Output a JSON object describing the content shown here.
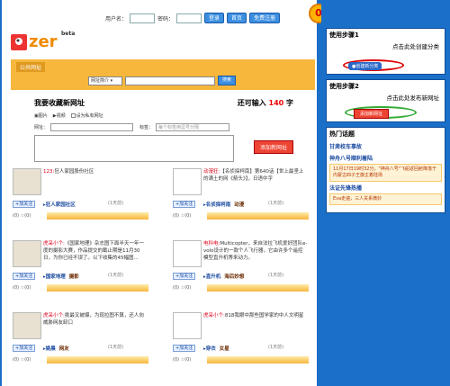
{
  "header": {
    "username_label": "用户名：",
    "password_label": "密码：",
    "login": "登录",
    "home": "首页",
    "register": "免费注册",
    "notice_count": "0",
    "logo_text": "zer",
    "beta": "beta"
  },
  "tabs": {
    "public": "公共网址"
  },
  "search": {
    "select": "网址简介",
    "button": "搜索"
  },
  "post": {
    "title": "我要收藏新网址",
    "remain_label": "还可输入",
    "remain_count": "140",
    "remain_unit": "字",
    "opt_image": "图片",
    "opt_video": "视频",
    "opt_private": "设为私有网址",
    "url_label": "网址：",
    "tag_label": "标签：",
    "tag_placeholder": "每个标签用逗号分隔",
    "add_button": "添加新网址"
  },
  "cards": [
    {
      "user": "123:",
      "text": "狂人家园股份社区",
      "time": "(1天前)",
      "follow": "加关注",
      "stat": "(0) ☆(0)",
      "tag1": "狂人家园社区",
      "tag2": ""
    },
    {
      "user": "动漫狂:",
      "text": "【名侦探柯南】第640话【世上最坚上的满土的网《箭头》】，日语中字",
      "time": "(1天前)",
      "follow": "加关注",
      "stat": "(0) ☆(0)",
      "tag1": "名侦探柯南",
      "tag2": "动漫"
    },
    {
      "user": "虎采小个:",
      "text": "《国家地理》杂志图下面半天一年一度的摄影大赛，作品提交的截止期是11月30日，为你已经不误了。以下收集的45幅图...",
      "time": "(1天前)",
      "follow": "加关注",
      "stat": "(0) ☆(0)",
      "tag1": "国家地理",
      "tag2": "摄影"
    },
    {
      "user": "电科电:",
      "text": "Multicopter，来自法拉飞机爱好团队e-volo设计的一款个人飞行器，它由许多个遥控模型直升机等来动力。",
      "time": "(1天前)",
      "follow": "加关注",
      "stat": "(0) ☆(0)",
      "tag1": "直升机",
      "tag2": "海后妙想"
    },
    {
      "user": "虎采小个:",
      "text": "挑最叉被爆，为现拉图不算，还人向威胁网友卸口",
      "time": "(1天前)",
      "follow": "加关注",
      "stat": "(0) ☆(0)",
      "tag1": "姚晨",
      "tag2": "网友"
    },
    {
      "user": "虎采小个:",
      "text": "818我眼中那些国学家的中人文明星",
      "time": "(1天前)",
      "follow": "加关注",
      "stat": "(0) ☆(0)",
      "tag1": "穿衣",
      "tag2": "女星"
    }
  ],
  "sidebar": {
    "step1_title": "使用步骤1",
    "step1_hint": "点击此处创建分类",
    "step1_btn": "创建新分类",
    "step2_title": "使用步骤2",
    "step2_hint": "点击此处发布新网址",
    "step2_btn": "添加新网址",
    "hot_title": "热门话题",
    "topic1": "甘肃校车事故",
    "topic2": "神舟八号顺利着陆",
    "topic2_note": "11月17日19时32分，\"神舟八号\"飞船返回舱降落于内蒙古四子王旗主着陆场",
    "topic3": "法证先锋热播",
    "topic3_note": "Eva走遍，三人关系微妙"
  }
}
